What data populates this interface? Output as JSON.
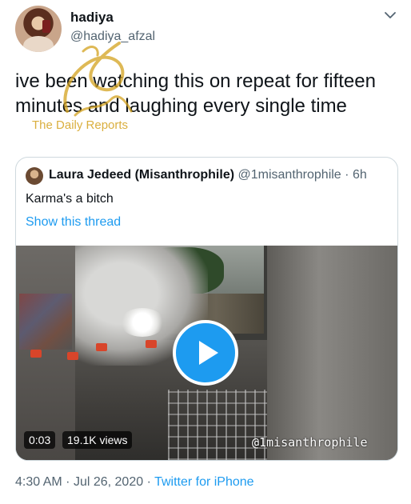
{
  "tweet": {
    "author_name": "hadiya",
    "author_handle": "@hadiya_afzal",
    "text": "ive been watching this on repeat for fifteen minutes and laughing every single time"
  },
  "watermark": {
    "text": "The Daily Reports",
    "color": "#d4a21e"
  },
  "quoted_tweet": {
    "author_name": "Laura Jedeed (Misanthrophile)",
    "author_handle": "@1misanthrophile",
    "separator": "·",
    "age": "6h",
    "text": "Karma's a bitch",
    "show_thread_label": "Show this thread",
    "video": {
      "timestamp": "0:03",
      "views": "19.1K views",
      "watermark": "@1misanthrophile"
    }
  },
  "footer": {
    "time": "4:30 AM",
    "sep1": "·",
    "date": "Jul 26, 2020",
    "sep2": "·",
    "source": "Twitter for iPhone"
  },
  "colors": {
    "accent": "#1d9bf0",
    "text": "#0f1419",
    "muted": "#536471",
    "border": "#cfd9de"
  },
  "icons": [
    "chevron-down-icon",
    "play-icon"
  ]
}
